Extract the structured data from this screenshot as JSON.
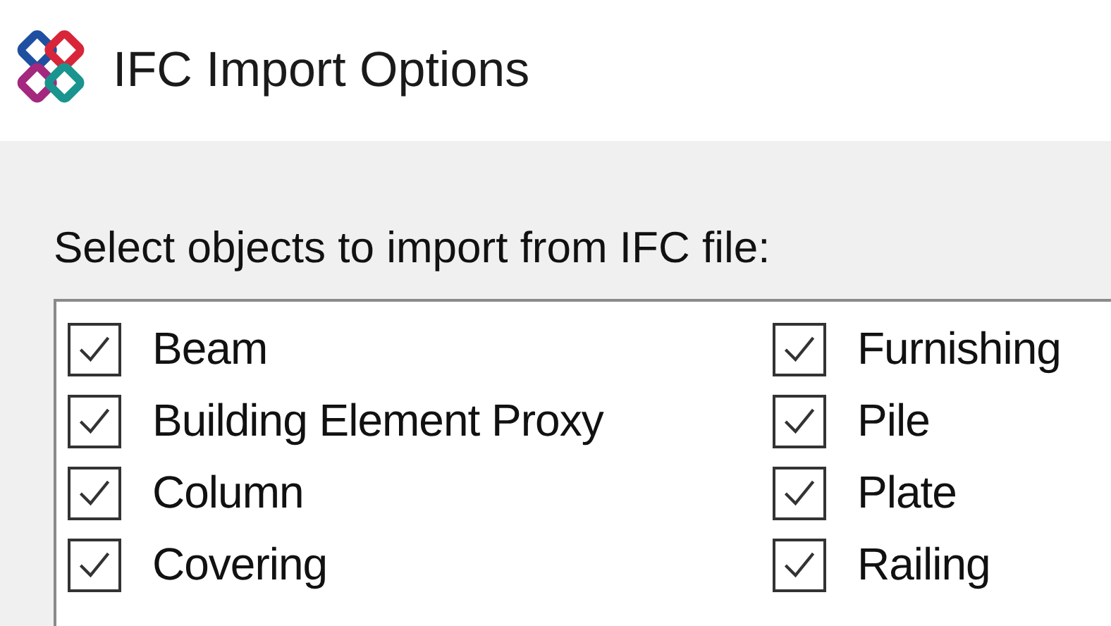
{
  "window": {
    "title": "IFC Import Options"
  },
  "prompt": "Select objects to import from IFC file:",
  "columns": [
    [
      {
        "label": "Beam",
        "checked": true
      },
      {
        "label": "Building Element Proxy",
        "checked": true
      },
      {
        "label": "Column",
        "checked": true
      },
      {
        "label": "Covering",
        "checked": true
      }
    ],
    [
      {
        "label": "Furnishing",
        "checked": true
      },
      {
        "label": "Pile",
        "checked": true
      },
      {
        "label": "Plate",
        "checked": true
      },
      {
        "label": "Railing",
        "checked": true
      }
    ]
  ]
}
